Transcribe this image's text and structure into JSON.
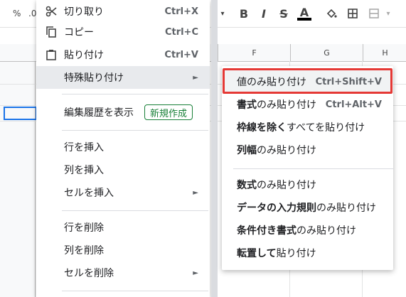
{
  "toolbar": {
    "percent": "%",
    "decimal": ".0",
    "bold": "B",
    "italic": "I",
    "strike": "S",
    "text_color": "A"
  },
  "columns": [
    "F",
    "G",
    "H"
  ],
  "menu": {
    "items": [
      {
        "label": "切り取り",
        "shortcut": "Ctrl+X",
        "icon": "scissors-icon"
      },
      {
        "label": "コピー",
        "shortcut": "Ctrl+C",
        "icon": "copy-icon"
      },
      {
        "label": "貼り付け",
        "shortcut": "Ctrl+V",
        "icon": "clipboard-icon"
      },
      {
        "label": "特殊貼り付け",
        "arrow": "►"
      },
      {
        "label": "編集履歴を表示",
        "badge": "新規作成"
      },
      {
        "label": "行を挿入"
      },
      {
        "label": "列を挿入"
      },
      {
        "label": "セルを挿入",
        "arrow": "►"
      },
      {
        "label": "行を削除"
      },
      {
        "label": "列を削除"
      },
      {
        "label": "セルを削除",
        "arrow": "►"
      }
    ]
  },
  "submenu": {
    "items": [
      {
        "bold": "",
        "rest": "値のみ貼り付け",
        "shortcut": "Ctrl+Shift+V"
      },
      {
        "bold": "書式",
        "rest": "のみ貼り付け",
        "shortcut": "Ctrl+Alt+V"
      },
      {
        "bold": "枠線を除く",
        "rest": "すべてを貼り付け"
      },
      {
        "bold": "列幅",
        "rest": "のみ貼り付け"
      },
      {
        "bold": "数式",
        "rest": "のみ貼り付け"
      },
      {
        "bold": "データの入力規則",
        "rest": "のみ貼り付け"
      },
      {
        "bold": "条件付き書式",
        "rest": "のみ貼り付け"
      },
      {
        "bold": "転置して",
        "rest": "貼り付け"
      }
    ]
  },
  "colors": {
    "highlight_border": "#e53935",
    "badge": "#188038",
    "selection": "#1a73e8"
  }
}
